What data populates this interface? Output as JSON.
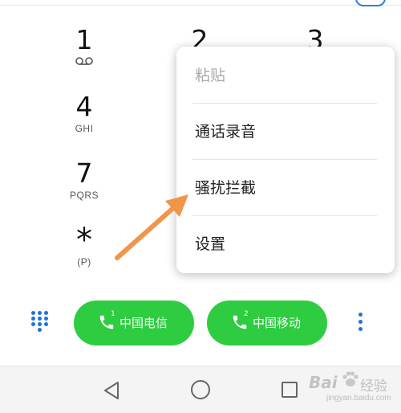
{
  "dialpad": {
    "keys": [
      {
        "digit": "1",
        "sub": ""
      },
      {
        "digit": "2",
        "sub": ""
      },
      {
        "digit": "3",
        "sub": ""
      },
      {
        "digit": "4",
        "sub": "GHI"
      },
      {
        "digit": "7",
        "sub": "PQRS"
      },
      {
        "digit": "*",
        "sub": "(P)"
      }
    ]
  },
  "menu": {
    "items": [
      {
        "label": "粘贴",
        "enabled": false
      },
      {
        "label": "通话录音",
        "enabled": true
      },
      {
        "label": "骚扰拦截",
        "enabled": true
      },
      {
        "label": "设置",
        "enabled": true
      }
    ]
  },
  "calls": [
    {
      "sim": "1",
      "label": "中国电信"
    },
    {
      "sim": "2",
      "label": "中国移动"
    }
  ],
  "colors": {
    "call_button": "#2ecc40",
    "accent_blue": "#1e72d9",
    "arrow": "#f0954a"
  },
  "icons": {
    "voicemail": "voicemail-icon",
    "dialpad": "dialpad-icon",
    "more": "more-vert-icon",
    "back": "nav-back-icon",
    "home": "nav-home-icon",
    "recents": "nav-recents-icon"
  },
  "watermark": {
    "brand": "Bai",
    "suffix": "经验",
    "url": "jingyan.baidu.com"
  }
}
